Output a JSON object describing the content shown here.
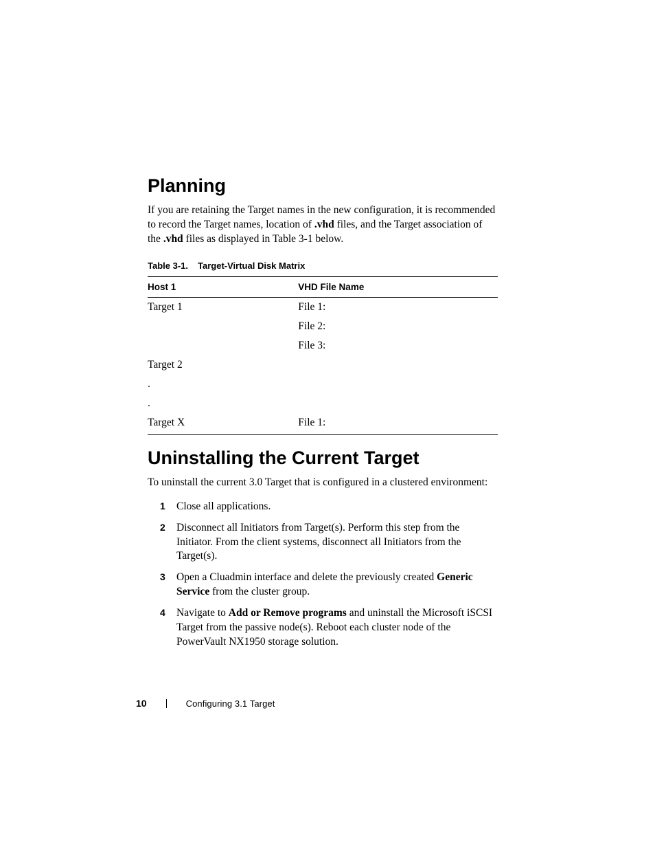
{
  "section1": {
    "heading": "Planning",
    "para_before_bold1": "If you are retaining the Target names in the new configuration, it is recommended to record the Target names, location of ",
    "bold1": ".vhd",
    "para_mid1": " files, and the Target association of the ",
    "bold2": ".vhd",
    "para_after_bold2": " files as displayed in Table 3-1 below."
  },
  "table": {
    "caption_num": "Table 3-1.",
    "caption_title": "Target-Virtual Disk Matrix",
    "header1": "Host 1",
    "header2": "VHD File Name",
    "rows": {
      "r0c0": "Target 1",
      "r0c1": "File 1:",
      "r1c0": "",
      "r1c1": "File 2:",
      "r2c0": "",
      "r2c1": "File 3:",
      "r3c0": "Target 2",
      "r3c1": "",
      "r4c0": ".",
      "r4c1": "",
      "r5c0": ".",
      "r5c1": "",
      "r6c0": "Target X",
      "r6c1": "File 1:"
    }
  },
  "section2": {
    "heading": "Uninstalling the Current Target",
    "intro": "To uninstall the current 3.0 Target that is configured in a clustered environment:",
    "steps": {
      "s1": "Close all applications.",
      "s2": "Disconnect all Initiators from Target(s). Perform this step from the Initiator. From the client systems, disconnect all Initiators from the Target(s).",
      "s3_before_bold": "Open a Cluadmin interface and delete the previously created ",
      "s3_bold": "Generic Service",
      "s3_after_bold": " from the cluster group.",
      "s4_before_bold": "Navigate to ",
      "s4_bold": "Add or Remove programs",
      "s4_after_bold": " and uninstall the Microsoft iSCSI Target from the passive node(s). Reboot each cluster node of the PowerVault NX1950 storage solution."
    }
  },
  "footer": {
    "page_num": "10",
    "title": "Configuring 3.1 Target"
  }
}
